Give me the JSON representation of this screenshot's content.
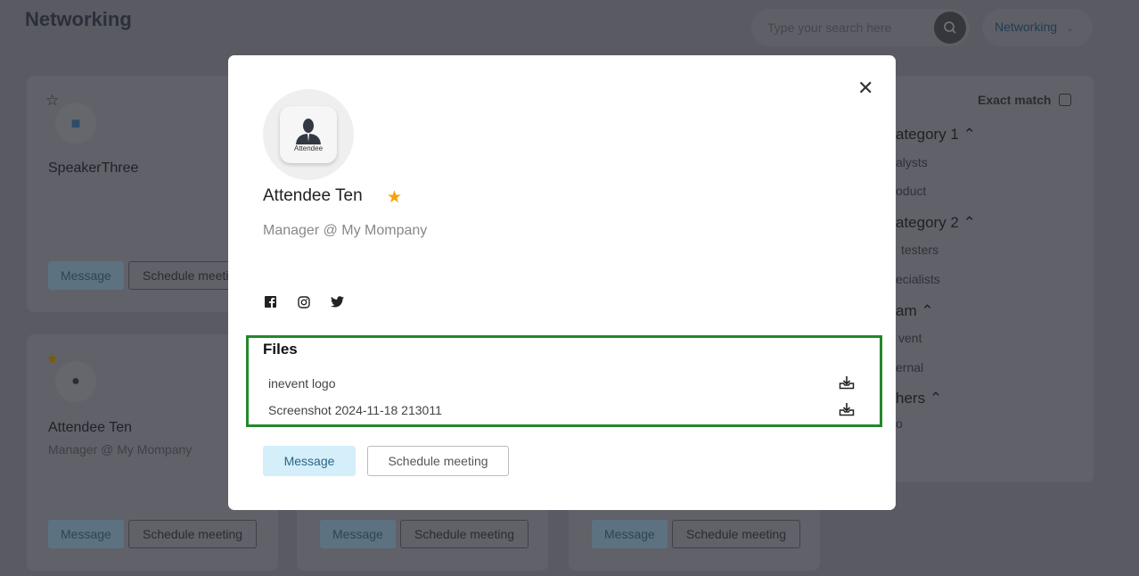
{
  "header": {
    "title": "Networking",
    "search_placeholder": "Type your search here",
    "dropdown": "Networking"
  },
  "cards": [
    {
      "name": "SpeakerThree",
      "subtitle": "",
      "avatar_label": "Speaker",
      "starred": false,
      "message": "Message",
      "schedule": "Schedule meeting"
    },
    {
      "name": "Attendee Ten",
      "subtitle": "Manager @ My Mompany",
      "avatar_label": "Attendee",
      "starred": true,
      "message": "Message",
      "schedule": "Schedule meeting"
    },
    {
      "message": "Message",
      "schedule": "Schedule meeting"
    },
    {
      "message": "Message",
      "schedule": "Schedule meeting"
    }
  ],
  "filters": {
    "exact_match": "Exact match",
    "groups": [
      {
        "title": "ategory 1",
        "items": [
          "alysts",
          "oduct"
        ]
      },
      {
        "title": "ategory 2",
        "items": [
          "testers",
          "ecialists"
        ]
      },
      {
        "title": "am",
        "items": [
          "vent",
          "ernal"
        ]
      },
      {
        "title": "hers",
        "items": [
          "o"
        ]
      }
    ]
  },
  "modal": {
    "name": "Attendee Ten",
    "role": "Manager @ My Mompany",
    "avatar_label": "Attendee",
    "starred": true,
    "social": [
      "facebook-icon",
      "instagram-icon",
      "twitter-icon"
    ],
    "files_title": "Files",
    "files": [
      "inevent logo",
      "Screenshot 2024-11-18 213011"
    ],
    "message": "Message",
    "schedule": "Schedule meeting"
  },
  "colors": {
    "accent_star": "#f5a30a",
    "highlight_border": "#23882a",
    "message_bg": "#d4eefa"
  }
}
